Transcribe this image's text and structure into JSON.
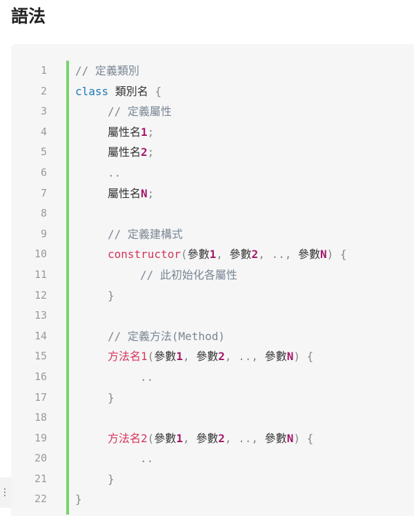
{
  "page": {
    "title": "語法"
  },
  "code": {
    "line_numbers": [
      "1",
      "2",
      "3",
      "4",
      "5",
      "6",
      "7",
      "8",
      "9",
      "10",
      "11",
      "12",
      "13",
      "14",
      "15",
      "16",
      "17",
      "18",
      "19",
      "20",
      "21",
      "22"
    ],
    "l1_comment": "// 定義類別",
    "l2_kw": "class",
    "l2_name": " 類別名 ",
    "l2_brace": "{",
    "l3_comment": "// 定義屬性",
    "l4_text": "屬性名",
    "l4_num": "1",
    "l4_semi": ";",
    "l5_text": "屬性名",
    "l5_num": "2",
    "l5_semi": ";",
    "l6_dots": "..",
    "l7_text": "屬性名",
    "l7_num": "N",
    "l7_semi": ";",
    "l9_comment": "// 定義建構式",
    "l10_fn": "constructor",
    "l10_open": "(",
    "l10_p1": "參數",
    "l10_n1": "1",
    "l10_sep1": ", ",
    "l10_p2": "參數",
    "l10_n2": "2",
    "l10_sep2": ", .., ",
    "l10_p3": "參數",
    "l10_n3": "N",
    "l10_close": ") {",
    "l11_comment": "// 此初始化各屬性",
    "l12_brace": "}",
    "l14_comment": "// 定義方法(Method)",
    "l15_fn": "方法名",
    "l15_fnnum": "1",
    "l15_open": "(",
    "l15_p1": "參數",
    "l15_n1": "1",
    "l15_sep1": ", ",
    "l15_p2": "參數",
    "l15_n2": "2",
    "l15_sep2": ", .., ",
    "l15_p3": "參數",
    "l15_n3": "N",
    "l15_close": ") {",
    "l16_dots": "..",
    "l17_brace": "}",
    "l19_fn": "方法名",
    "l19_fnnum": "2",
    "l19_open": "(",
    "l19_p1": "參數",
    "l19_n1": "1",
    "l19_sep1": ", ",
    "l19_p2": "參數",
    "l19_n2": "2",
    "l19_sep2": ", .., ",
    "l19_p3": "參數",
    "l19_n3": "N",
    "l19_close": ") {",
    "l20_dots": "..",
    "l21_brace": "}",
    "l22_brace": "}"
  },
  "side_handle": {
    "icon": "⋮"
  },
  "colors": {
    "accent_bar": "#77d46b",
    "keyword": "#1c7ab8",
    "function": "#d6335b",
    "number": "#a3186a",
    "comment": "#7a8794"
  }
}
